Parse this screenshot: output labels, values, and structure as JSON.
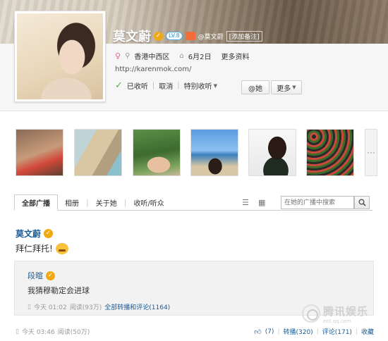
{
  "profile": {
    "name": "莫文蔚",
    "level_badge": "LV.8",
    "handle": "@莫文蔚",
    "add_note": "[添加备注]",
    "location": "香港中西区",
    "birthday": "6月2日",
    "more_info": "更多资料",
    "url": "http://karenmok.com/",
    "followed_label": "已收听",
    "cancel_label": "取消",
    "special_follow": "特别收听",
    "at_button": "@她",
    "more_button": "更多"
  },
  "photos": {
    "more_glyph": "···"
  },
  "tabs": {
    "items": [
      "全部广播",
      "相册",
      "关于她",
      "收听/听众"
    ],
    "search_placeholder": "在她的广播中搜索"
  },
  "post": {
    "author": "莫文蔚",
    "text": "拜仁拜托!",
    "repost": {
      "author": "段暄",
      "text": "我猜穆勒定会进球",
      "time": "今天 01:02",
      "reads": "阅读(93万)",
      "link": "全部转播和评论(1164)"
    },
    "footer": {
      "time": "今天 03:46",
      "reads": "阅读(50万)",
      "likes": "(7)",
      "retweet": "转播(320)",
      "comment": "评论(171)",
      "favorite": "收藏"
    }
  },
  "watermark": {
    "cn": "腾讯娱乐",
    "en": "ent.qq.com"
  },
  "colors": {
    "link": "#1a5c96",
    "verified": "#f1a812",
    "follow_check": "#4db24d"
  }
}
